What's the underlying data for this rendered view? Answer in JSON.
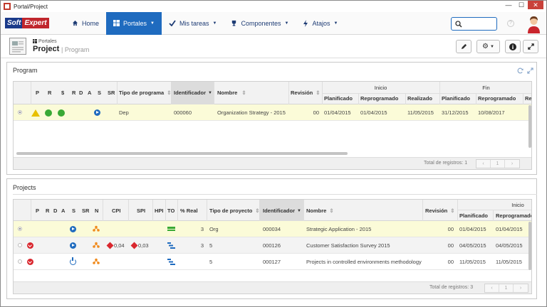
{
  "window": {
    "title": "Portal/Project",
    "close": "✕",
    "min": "—",
    "max": "☐"
  },
  "nav": {
    "home": "Home",
    "portales": "Portales",
    "tareas": "Mis tareas",
    "componentes": "Componentes",
    "atajos": "Atajos"
  },
  "logo": {
    "part1": "Soft",
    "part2": "Expert"
  },
  "header": {
    "breadcrumb_small": "Portales",
    "title": "Project",
    "subtitle": "| Program"
  },
  "program": {
    "title": "Program",
    "columns": {
      "p": "P",
      "r": "R",
      "s": "$",
      "r2": "R",
      "d": "D",
      "a": "A",
      "s2": "S",
      "sr": "SR",
      "tipo": "Tipo de programa",
      "id": "Identificador",
      "nombre": "Nombre",
      "revision": "Revisión",
      "inicio": "Inicio",
      "fin": "Fin",
      "planificado": "Planificado",
      "reprogramado": "Reprogramado",
      "realizado": "Realizado",
      "planificado2": "Planificado",
      "reprogramado2": "Reprogramado",
      "re": "Re"
    },
    "row": {
      "tipo": "Dep",
      "id": "000060",
      "nombre": "Organization Strategy - 2015",
      "revision": "00",
      "planificado": "01/04/2015",
      "reprogramado": "01/04/2015",
      "realizado": "11/05/2015",
      "planificado2": "31/12/2015",
      "reprogramado2": "10/08/2017"
    },
    "footer": "Total de registros: 1",
    "page": "1"
  },
  "projects": {
    "title": "Projects",
    "columns": {
      "p": "P",
      "r": "R",
      "d": "D",
      "a": "A",
      "s": "S",
      "sr": "SR",
      "n": "N",
      "cpi": "CPI",
      "spi": "SPI",
      "hpi": "HPI",
      "to": "TO",
      "real": "% Real",
      "tipo": "Tipo de proyecto",
      "id": "Identificador",
      "nombre": "Nombre",
      "revision": "Revisión",
      "inicio": "Inicio",
      "planificado": "Planificado",
      "reprogramado": "Reprogramado"
    },
    "rows": [
      {
        "real": "3",
        "tipo": "Org",
        "id": "000034",
        "nombre": "Strategic Application - 2015",
        "revision": "00",
        "planificado": "01/04/2015",
        "reprogramado": "01/04/2015",
        "cpi": "",
        "spi": ""
      },
      {
        "real": "3",
        "tipo": "5",
        "id": "000126",
        "nombre": "Customer Satisfaction Survey 2015",
        "revision": "00",
        "planificado": "04/05/2015",
        "reprogramado": "04/05/2015",
        "cpi": "0,04",
        "spi": "0,03"
      },
      {
        "real": "",
        "tipo": "5",
        "id": "000127",
        "nombre": "Projects in controlled environments methodology",
        "revision": "00",
        "planificado": "11/05/2015",
        "reprogramado": "11/05/2015",
        "cpi": "",
        "spi": ""
      }
    ],
    "footer": "Total de registros: 3",
    "page": "1"
  },
  "colors": {
    "accent": "#1f6bbf",
    "selected_row": "#fbfbd8",
    "danger": "#d9272e",
    "ok": "#39a935",
    "warn": "#e8c000"
  }
}
